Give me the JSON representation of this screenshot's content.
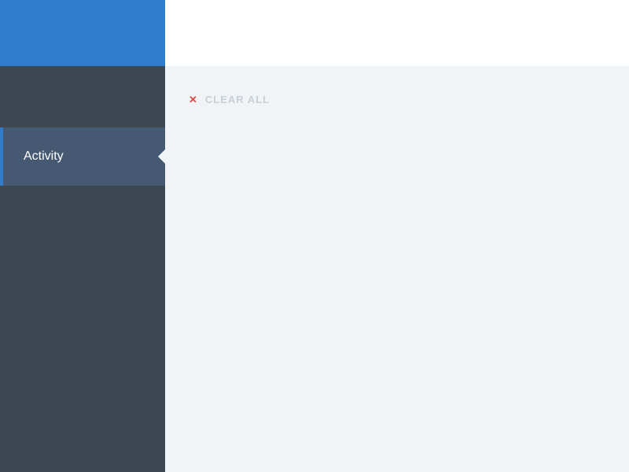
{
  "colors": {
    "accent_blue": "#2f7bcc",
    "sidebar_bg": "#3d4751",
    "sidebar_active_bg": "#455a72",
    "content_bg": "#f1f4f7",
    "clear_icon": "#d94b4b",
    "clear_text": "#c7cfd6"
  },
  "sidebar": {
    "items": [
      {
        "label": "Activity",
        "active": true
      }
    ]
  },
  "actions": {
    "clear_all": {
      "label": "CLEAR ALL",
      "icon": "close-icon"
    }
  }
}
